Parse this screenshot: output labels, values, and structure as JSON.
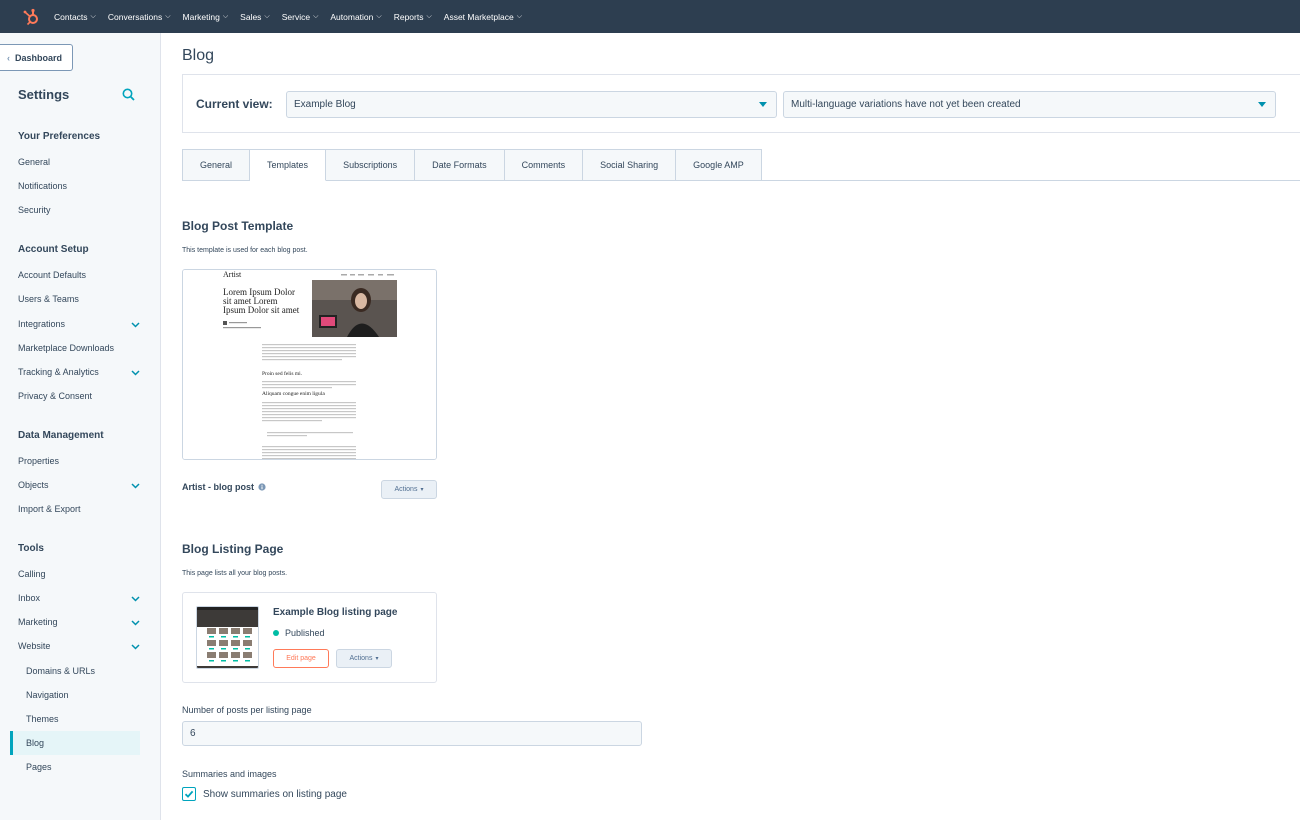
{
  "topnav": {
    "items": [
      "Contacts",
      "Conversations",
      "Marketing",
      "Sales",
      "Service",
      "Automation",
      "Reports",
      "Asset Marketplace"
    ]
  },
  "sidebar": {
    "dashboard_label": "Dashboard",
    "title": "Settings",
    "sections": {
      "preferences": "Your Preferences",
      "account_setup": "Account Setup",
      "data_management": "Data Management",
      "tools": "Tools"
    },
    "items": {
      "general": "General",
      "notifications": "Notifications",
      "security": "Security",
      "account_defaults": "Account Defaults",
      "users_teams": "Users & Teams",
      "integrations": "Integrations",
      "marketplace_downloads": "Marketplace Downloads",
      "tracking_analytics": "Tracking & Analytics",
      "privacy_consent": "Privacy & Consent",
      "properties": "Properties",
      "objects": "Objects",
      "import_export": "Import & Export",
      "calling": "Calling",
      "inbox": "Inbox",
      "marketing": "Marketing",
      "website": "Website",
      "domains_urls": "Domains & URLs",
      "navigation": "Navigation",
      "themes": "Themes",
      "blog": "Blog",
      "pages": "Pages"
    }
  },
  "main": {
    "page_title": "Blog",
    "current_view_label": "Current view:",
    "current_view_value": "Example Blog",
    "language_value": "Multi-language variations have not yet been created",
    "tabs": [
      "General",
      "Templates",
      "Subscriptions",
      "Date Formats",
      "Comments",
      "Social Sharing",
      "Google AMP"
    ],
    "active_tab": "Templates",
    "post_template": {
      "heading": "Blog Post Template",
      "description": "This template is used for each blog post.",
      "preview_brand": "Artist",
      "preview_headline_1": "Lorem Ipsum Dolor",
      "preview_headline_2": "sit amet Lorem",
      "preview_headline_3": "Ipsum Dolor sit amet",
      "preview_sub_1": "Proin sed felis mi.",
      "preview_sub_2": "Aliquam congue enim ligula",
      "name": "Artist - blog post",
      "actions_label": "Actions"
    },
    "listing": {
      "heading": "Blog Listing Page",
      "description": "This page lists all your blog posts.",
      "title": "Example Blog listing page",
      "status": "Published",
      "edit_label": "Edit page",
      "actions_label": "Actions"
    },
    "posts_per_page_label": "Number of posts per listing page",
    "posts_per_page_value": "6",
    "summaries_label": "Summaries and images",
    "show_summaries_label": "Show summaries on listing page",
    "show_summaries_checked": true
  },
  "colors": {
    "nav_bg": "#2d3e50",
    "accent": "#00a4bd",
    "primary_orange": "#ff7a59",
    "published": "#00bda5"
  }
}
